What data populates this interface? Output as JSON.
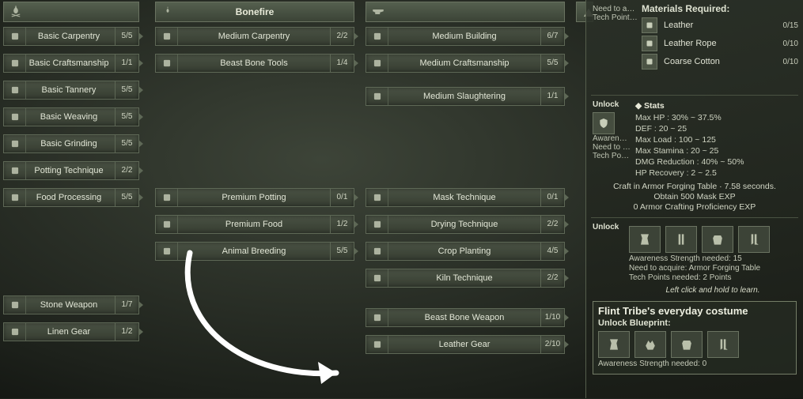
{
  "columns": {
    "c2_header": "Bonefire",
    "c1": [
      {
        "label": "Basic Carpentry",
        "count": "5/5"
      },
      {
        "label": "Basic Craftsmanship",
        "count": "1/1"
      },
      {
        "label": "Basic Tannery",
        "count": "5/5"
      },
      {
        "label": "Basic Weaving",
        "count": "5/5"
      },
      {
        "label": "Basic Grinding",
        "count": "5/5"
      },
      {
        "label": "Potting Technique",
        "count": "2/2"
      },
      {
        "label": "Food Processing",
        "count": "5/5"
      },
      {
        "label": "Stone Weapon",
        "count": "1/7"
      },
      {
        "label": "Linen Gear",
        "count": "1/2"
      }
    ],
    "c2": [
      {
        "label": "Medium Carpentry",
        "count": "2/2"
      },
      {
        "label": "Beast Bone Tools",
        "count": "1/4"
      },
      {
        "label": "Premium Potting",
        "count": "0/1"
      },
      {
        "label": "Premium Food",
        "count": "1/2"
      },
      {
        "label": "Animal Breeding",
        "count": "5/5"
      }
    ],
    "c3": [
      {
        "label": "Medium Building",
        "count": "6/7"
      },
      {
        "label": "Medium Craftsmanship",
        "count": "5/5"
      },
      {
        "label": "Medium Slaughtering",
        "count": "1/1"
      },
      {
        "label": "Mask Technique",
        "count": "0/1"
      },
      {
        "label": "Drying Technique",
        "count": "2/2"
      },
      {
        "label": "Crop Planting",
        "count": "4/5"
      },
      {
        "label": "Kiln Technique",
        "count": "2/2"
      },
      {
        "label": "Beast Bone Weapon",
        "count": "1/10"
      },
      {
        "label": "Leather Gear",
        "count": "2/10"
      }
    ]
  },
  "panel": {
    "trunc_need": "Need to a…",
    "trunc_tech": "Tech Point…",
    "materials_title": "Materials Required:",
    "materials": [
      {
        "name": "Leather",
        "count": "0/15"
      },
      {
        "name": "Leather Rope",
        "count": "0/10"
      },
      {
        "name": "Coarse Cotton",
        "count": "0/10"
      }
    ],
    "unlock_label": "Unlock",
    "side_awareness": "Awarene…",
    "side_need": "Need to a…",
    "side_tech": "Tech Poi…",
    "stats_title": "Stats",
    "stats": [
      "Max HP : 30% ~ 37.5%",
      "DEF : 20 ~ 25",
      "Max Load : 100 ~ 125",
      "Max Stamina : 20 ~ 25",
      "DMG Reduction : 40% ~ 50%",
      "HP Recovery : 2 ~ 2.5"
    ],
    "craft": [
      "Craft in Armor Forging Table · 7.58 seconds.",
      "Obtain 500 Mask EXP",
      "0 Armor Crafting Proficiency EXP"
    ],
    "req": [
      "Awareness Strength needed: 15",
      "Need to acquire: Armor Forging Table",
      "Tech Points needed: 2 Points"
    ],
    "learn_hint": "Left click and hold to learn.",
    "box_title": "Flint Tribe's everyday costume",
    "box_unlock": "Unlock Blueprint:",
    "box_aware": "Awareness Strength needed: 0"
  }
}
